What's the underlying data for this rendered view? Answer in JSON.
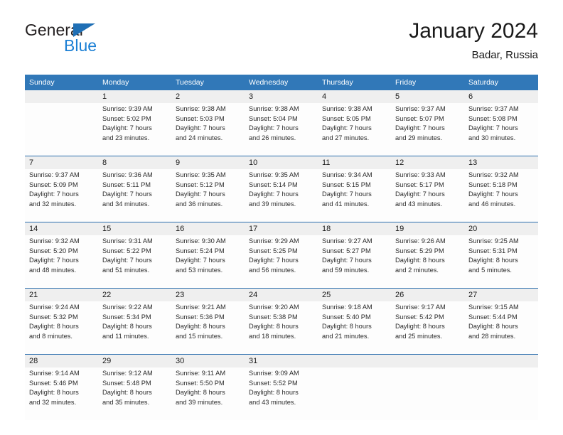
{
  "brand": {
    "name_part1": "General",
    "name_part2": "Blue",
    "accent_color": "#1b7fd4",
    "triangle_color": "#1f6fb5"
  },
  "header": {
    "title": "January 2024",
    "subtitle": "Badar, Russia"
  },
  "theme": {
    "header_row_bg": "#3178b8",
    "daynum_bg": "#efefef",
    "week_divider": "#2c6fae"
  },
  "weekday_headers": [
    "Sunday",
    "Monday",
    "Tuesday",
    "Wednesday",
    "Thursday",
    "Friday",
    "Saturday"
  ],
  "weeks": [
    [
      {
        "day": "",
        "sunrise": "",
        "sunset": "",
        "daylight_line1": "",
        "daylight_line2": ""
      },
      {
        "day": "1",
        "sunrise": "Sunrise: 9:39 AM",
        "sunset": "Sunset: 5:02 PM",
        "daylight_line1": "Daylight: 7 hours",
        "daylight_line2": "and 23 minutes."
      },
      {
        "day": "2",
        "sunrise": "Sunrise: 9:38 AM",
        "sunset": "Sunset: 5:03 PM",
        "daylight_line1": "Daylight: 7 hours",
        "daylight_line2": "and 24 minutes."
      },
      {
        "day": "3",
        "sunrise": "Sunrise: 9:38 AM",
        "sunset": "Sunset: 5:04 PM",
        "daylight_line1": "Daylight: 7 hours",
        "daylight_line2": "and 26 minutes."
      },
      {
        "day": "4",
        "sunrise": "Sunrise: 9:38 AM",
        "sunset": "Sunset: 5:05 PM",
        "daylight_line1": "Daylight: 7 hours",
        "daylight_line2": "and 27 minutes."
      },
      {
        "day": "5",
        "sunrise": "Sunrise: 9:37 AM",
        "sunset": "Sunset: 5:07 PM",
        "daylight_line1": "Daylight: 7 hours",
        "daylight_line2": "and 29 minutes."
      },
      {
        "day": "6",
        "sunrise": "Sunrise: 9:37 AM",
        "sunset": "Sunset: 5:08 PM",
        "daylight_line1": "Daylight: 7 hours",
        "daylight_line2": "and 30 minutes."
      }
    ],
    [
      {
        "day": "7",
        "sunrise": "Sunrise: 9:37 AM",
        "sunset": "Sunset: 5:09 PM",
        "daylight_line1": "Daylight: 7 hours",
        "daylight_line2": "and 32 minutes."
      },
      {
        "day": "8",
        "sunrise": "Sunrise: 9:36 AM",
        "sunset": "Sunset: 5:11 PM",
        "daylight_line1": "Daylight: 7 hours",
        "daylight_line2": "and 34 minutes."
      },
      {
        "day": "9",
        "sunrise": "Sunrise: 9:35 AM",
        "sunset": "Sunset: 5:12 PM",
        "daylight_line1": "Daylight: 7 hours",
        "daylight_line2": "and 36 minutes."
      },
      {
        "day": "10",
        "sunrise": "Sunrise: 9:35 AM",
        "sunset": "Sunset: 5:14 PM",
        "daylight_line1": "Daylight: 7 hours",
        "daylight_line2": "and 39 minutes."
      },
      {
        "day": "11",
        "sunrise": "Sunrise: 9:34 AM",
        "sunset": "Sunset: 5:15 PM",
        "daylight_line1": "Daylight: 7 hours",
        "daylight_line2": "and 41 minutes."
      },
      {
        "day": "12",
        "sunrise": "Sunrise: 9:33 AM",
        "sunset": "Sunset: 5:17 PM",
        "daylight_line1": "Daylight: 7 hours",
        "daylight_line2": "and 43 minutes."
      },
      {
        "day": "13",
        "sunrise": "Sunrise: 9:32 AM",
        "sunset": "Sunset: 5:18 PM",
        "daylight_line1": "Daylight: 7 hours",
        "daylight_line2": "and 46 minutes."
      }
    ],
    [
      {
        "day": "14",
        "sunrise": "Sunrise: 9:32 AM",
        "sunset": "Sunset: 5:20 PM",
        "daylight_line1": "Daylight: 7 hours",
        "daylight_line2": "and 48 minutes."
      },
      {
        "day": "15",
        "sunrise": "Sunrise: 9:31 AM",
        "sunset": "Sunset: 5:22 PM",
        "daylight_line1": "Daylight: 7 hours",
        "daylight_line2": "and 51 minutes."
      },
      {
        "day": "16",
        "sunrise": "Sunrise: 9:30 AM",
        "sunset": "Sunset: 5:24 PM",
        "daylight_line1": "Daylight: 7 hours",
        "daylight_line2": "and 53 minutes."
      },
      {
        "day": "17",
        "sunrise": "Sunrise: 9:29 AM",
        "sunset": "Sunset: 5:25 PM",
        "daylight_line1": "Daylight: 7 hours",
        "daylight_line2": "and 56 minutes."
      },
      {
        "day": "18",
        "sunrise": "Sunrise: 9:27 AM",
        "sunset": "Sunset: 5:27 PM",
        "daylight_line1": "Daylight: 7 hours",
        "daylight_line2": "and 59 minutes."
      },
      {
        "day": "19",
        "sunrise": "Sunrise: 9:26 AM",
        "sunset": "Sunset: 5:29 PM",
        "daylight_line1": "Daylight: 8 hours",
        "daylight_line2": "and 2 minutes."
      },
      {
        "day": "20",
        "sunrise": "Sunrise: 9:25 AM",
        "sunset": "Sunset: 5:31 PM",
        "daylight_line1": "Daylight: 8 hours",
        "daylight_line2": "and 5 minutes."
      }
    ],
    [
      {
        "day": "21",
        "sunrise": "Sunrise: 9:24 AM",
        "sunset": "Sunset: 5:32 PM",
        "daylight_line1": "Daylight: 8 hours",
        "daylight_line2": "and 8 minutes."
      },
      {
        "day": "22",
        "sunrise": "Sunrise: 9:22 AM",
        "sunset": "Sunset: 5:34 PM",
        "daylight_line1": "Daylight: 8 hours",
        "daylight_line2": "and 11 minutes."
      },
      {
        "day": "23",
        "sunrise": "Sunrise: 9:21 AM",
        "sunset": "Sunset: 5:36 PM",
        "daylight_line1": "Daylight: 8 hours",
        "daylight_line2": "and 15 minutes."
      },
      {
        "day": "24",
        "sunrise": "Sunrise: 9:20 AM",
        "sunset": "Sunset: 5:38 PM",
        "daylight_line1": "Daylight: 8 hours",
        "daylight_line2": "and 18 minutes."
      },
      {
        "day": "25",
        "sunrise": "Sunrise: 9:18 AM",
        "sunset": "Sunset: 5:40 PM",
        "daylight_line1": "Daylight: 8 hours",
        "daylight_line2": "and 21 minutes."
      },
      {
        "day": "26",
        "sunrise": "Sunrise: 9:17 AM",
        "sunset": "Sunset: 5:42 PM",
        "daylight_line1": "Daylight: 8 hours",
        "daylight_line2": "and 25 minutes."
      },
      {
        "day": "27",
        "sunrise": "Sunrise: 9:15 AM",
        "sunset": "Sunset: 5:44 PM",
        "daylight_line1": "Daylight: 8 hours",
        "daylight_line2": "and 28 minutes."
      }
    ],
    [
      {
        "day": "28",
        "sunrise": "Sunrise: 9:14 AM",
        "sunset": "Sunset: 5:46 PM",
        "daylight_line1": "Daylight: 8 hours",
        "daylight_line2": "and 32 minutes."
      },
      {
        "day": "29",
        "sunrise": "Sunrise: 9:12 AM",
        "sunset": "Sunset: 5:48 PM",
        "daylight_line1": "Daylight: 8 hours",
        "daylight_line2": "and 35 minutes."
      },
      {
        "day": "30",
        "sunrise": "Sunrise: 9:11 AM",
        "sunset": "Sunset: 5:50 PM",
        "daylight_line1": "Daylight: 8 hours",
        "daylight_line2": "and 39 minutes."
      },
      {
        "day": "31",
        "sunrise": "Sunrise: 9:09 AM",
        "sunset": "Sunset: 5:52 PM",
        "daylight_line1": "Daylight: 8 hours",
        "daylight_line2": "and 43 minutes."
      },
      {
        "day": "",
        "sunrise": "",
        "sunset": "",
        "daylight_line1": "",
        "daylight_line2": ""
      },
      {
        "day": "",
        "sunrise": "",
        "sunset": "",
        "daylight_line1": "",
        "daylight_line2": ""
      },
      {
        "day": "",
        "sunrise": "",
        "sunset": "",
        "daylight_line1": "",
        "daylight_line2": ""
      }
    ]
  ]
}
